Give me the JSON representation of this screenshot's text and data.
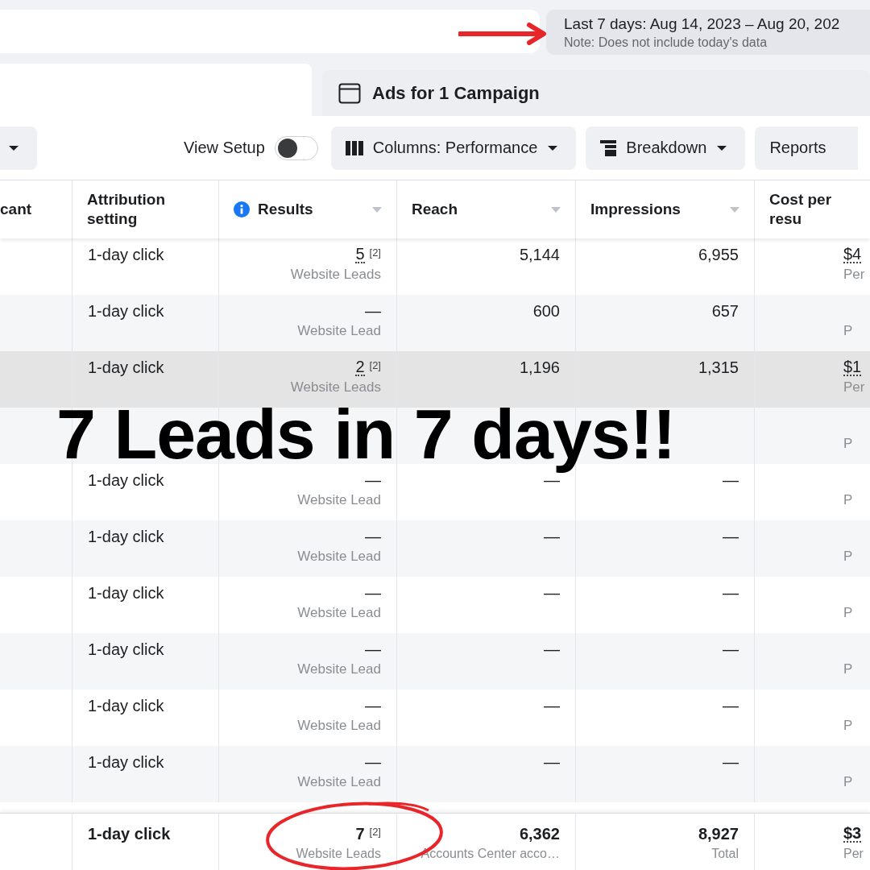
{
  "date_range": {
    "label": "Last 7 days: Aug 14, 2023 – Aug 20, 202",
    "note": "Note: Does not include today's data"
  },
  "tabs": [
    {
      "selected": true
    },
    {
      "label": "Ads for 1 Campaign",
      "selected": false
    }
  ],
  "toolbar": {
    "view_setup": {
      "label": "View Setup",
      "on": false
    },
    "buttons": [
      {
        "kind": "columns",
        "label": "Columns: Performance",
        "caret": true
      },
      {
        "kind": "breakdown",
        "label": "Breakdown",
        "caret": true
      },
      {
        "kind": "plain",
        "label": "Reports",
        "caret": false
      }
    ]
  },
  "table": {
    "columns": [
      {
        "label": "cant",
        "info": false,
        "sort": false
      },
      {
        "label": "Attribution setting",
        "info": false,
        "sort": false
      },
      {
        "label": "Results",
        "info": true,
        "sort": true
      },
      {
        "label": "Reach",
        "info": false,
        "sort": true
      },
      {
        "label": "Impressions",
        "info": false,
        "sort": true
      },
      {
        "label": "Cost per resu",
        "info": false,
        "sort": false
      }
    ],
    "rows": [
      {
        "highlighted": false,
        "attribution": "1-day click",
        "results": {
          "value": "5",
          "dotted": true,
          "note": "[2]",
          "sub": "Website Leads"
        },
        "reach": "5,144",
        "impressions": "6,955",
        "cost": {
          "value": "$4",
          "dotted": true,
          "sub": "Per"
        }
      },
      {
        "highlighted": false,
        "attribution": "1-day click",
        "results": {
          "value": "—",
          "dotted": false,
          "sub": "Website Lead"
        },
        "reach": "600",
        "impressions": "657",
        "cost": {
          "sub": "P"
        }
      },
      {
        "highlighted": true,
        "attribution": "1-day click",
        "results": {
          "value": "2",
          "dotted": true,
          "note": "[2]",
          "sub": "Website Leads"
        },
        "reach": "1,196",
        "impressions": "1,315",
        "cost": {
          "value": "$1",
          "dotted": true,
          "sub": "Per"
        }
      },
      {
        "highlighted": false,
        "cost": {
          "sub": "P"
        }
      },
      {
        "highlighted": false,
        "attribution": "1-day click",
        "results": {
          "value": "—",
          "dotted": false,
          "sub": "Website Lead"
        },
        "reach": "—",
        "impressions": "—",
        "cost": {
          "sub": "P"
        }
      },
      {
        "highlighted": false,
        "attribution": "1-day click",
        "results": {
          "value": "—",
          "dotted": false,
          "sub": "Website Lead"
        },
        "reach": "—",
        "impressions": "—",
        "cost": {
          "sub": "P"
        }
      },
      {
        "highlighted": false,
        "attribution": "1-day click",
        "results": {
          "value": "—",
          "dotted": false,
          "sub": "Website Lead"
        },
        "reach": "—",
        "impressions": "—",
        "cost": {
          "sub": "P"
        }
      },
      {
        "highlighted": false,
        "attribution": "1-day click",
        "results": {
          "value": "—",
          "dotted": false,
          "sub": "Website Lead"
        },
        "reach": "—",
        "impressions": "—",
        "cost": {
          "sub": "P"
        }
      },
      {
        "highlighted": false,
        "attribution": "1-day click",
        "results": {
          "value": "—",
          "dotted": false,
          "sub": "Website Lead"
        },
        "reach": "—",
        "impressions": "—",
        "cost": {
          "sub": "P"
        }
      },
      {
        "highlighted": false,
        "attribution": "1-day click",
        "results": {
          "value": "—",
          "dotted": false,
          "sub": "Website Lead"
        },
        "reach": "—",
        "impressions": "—",
        "cost": {
          "sub": "P"
        }
      }
    ],
    "totals": {
      "attribution": "1-day click",
      "results": {
        "value": "7",
        "note": "[2]",
        "sub": "Website Leads"
      },
      "reach": {
        "value": "6,362",
        "sub": "Accounts Center acco…"
      },
      "impressions": {
        "value": "8,927",
        "sub": "Total"
      },
      "cost": {
        "value": "$3",
        "dotted": true,
        "sub": "Per"
      }
    }
  },
  "overlay": {
    "headline": "7 Leads in 7 days!!"
  }
}
